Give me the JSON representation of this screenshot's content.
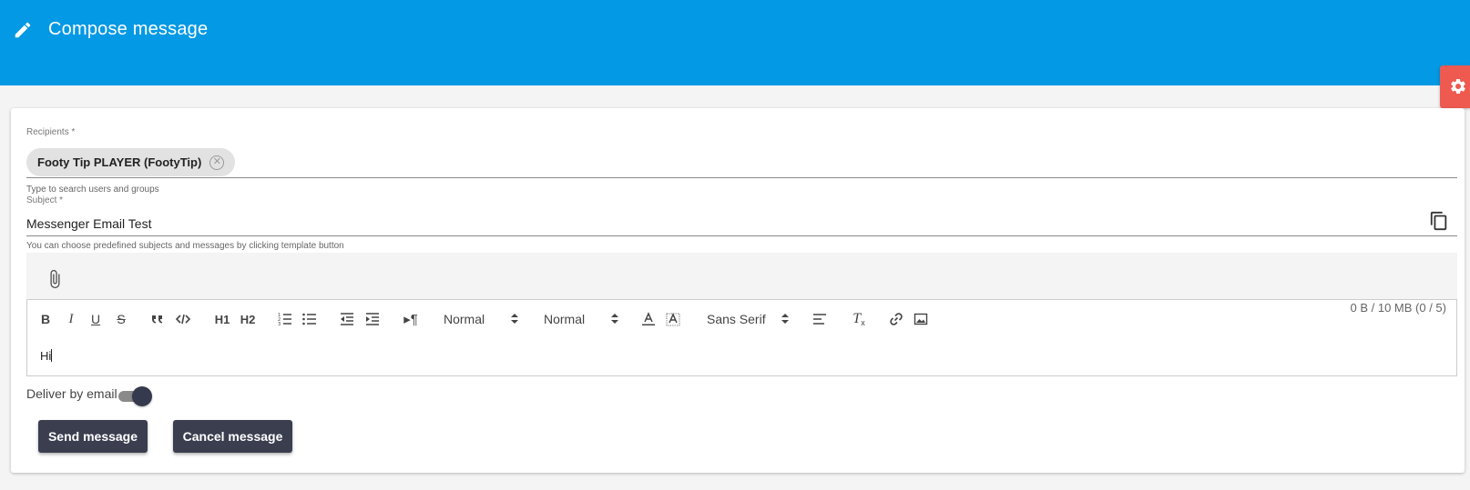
{
  "header": {
    "title": "Compose message",
    "icon": "pencil-icon",
    "background": "#0399e4"
  },
  "settings_tab": {
    "icon": "gear-icon",
    "color": "#ee5a50"
  },
  "recipients": {
    "label": "Recipients *",
    "chips": [
      {
        "label": "Footy Tip PLAYER (FootyTip)",
        "remove_icon": "close-circle-icon"
      }
    ],
    "hint": "Type to search users and groups"
  },
  "subject": {
    "label": "Subject *",
    "value": "Messenger Email Test",
    "template_icon": "copy-icon",
    "hint": "You can choose predefined subjects and messages by clicking template button"
  },
  "attachments": {
    "icon": "paperclip-icon",
    "info": "0 B / 10 MB (0 / 5)"
  },
  "toolbar": {
    "bold": "B",
    "italic": "I",
    "underline": "U",
    "strike": "S",
    "h1": "H1",
    "h2": "H2",
    "size_select": "Normal",
    "header_select": "Normal",
    "font_select": "Sans Serif",
    "icons": [
      "bold-icon",
      "italic-icon",
      "underline-icon",
      "strike-icon",
      "blockquote-icon",
      "code-block-icon",
      "h1-icon",
      "h2-icon",
      "ordered-list-icon",
      "bullet-list-icon",
      "outdent-icon",
      "indent-icon",
      "text-direction-icon",
      "text-color-icon",
      "background-color-icon",
      "align-icon",
      "clear-format-icon",
      "link-icon",
      "image-icon"
    ]
  },
  "editor": {
    "content": "Hi"
  },
  "deliver": {
    "label": "Deliver by email",
    "enabled": true
  },
  "actions": {
    "send_label": "Send message",
    "cancel_label": "Cancel message",
    "button_color": "#3a3e4f"
  }
}
